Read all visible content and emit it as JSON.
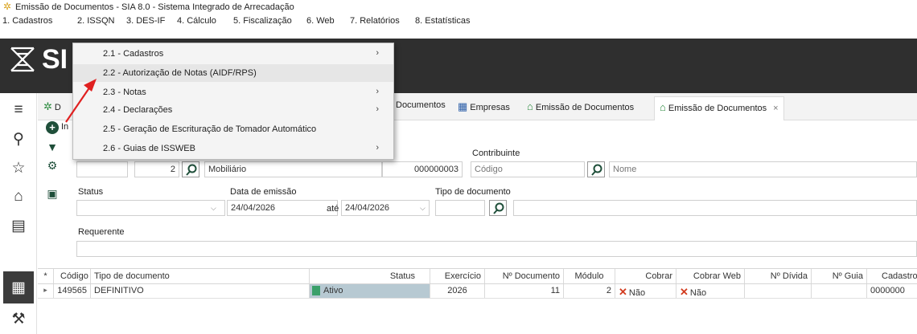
{
  "window": {
    "title": "Emissão de Documentos - SIA 8.0 - Sistema Integrado de Arrecadação"
  },
  "menubar": [
    "1. Cadastros",
    "2. ISSQN",
    "3. DES-IF",
    "4. Cálculo",
    "5. Fiscalização",
    "6. Web",
    "7. Relatórios",
    "8. Estatísticas"
  ],
  "brand": {
    "logo_text": "SI"
  },
  "dropdown": [
    {
      "label": "2.1 - Cadastros",
      "submenu": true
    },
    {
      "label": "2.2 - Autorização de Notas (AIDF/RPS)",
      "submenu": false
    },
    {
      "label": "2.3 - Notas",
      "submenu": true
    },
    {
      "label": "2.4 - Declarações",
      "submenu": true
    },
    {
      "label": "2.5 - Geração de Escrituração de Tomador Automático",
      "submenu": false
    },
    {
      "label": "2.6 - Guias de ISSWEB",
      "submenu": true
    }
  ],
  "tabs": {
    "first_partial": "D",
    "t1": "Documentos",
    "t2": "Empresas",
    "t3": "Emissão de Documentos",
    "t4": "Emissão de Documentos",
    "close": "×"
  },
  "toolbar": {
    "partial_label": "In"
  },
  "form": {
    "contribuinte_label": "Contribuinte",
    "row1_num": "2",
    "mobiliario": "Mobiliário",
    "code": "000000003",
    "codigo_placeholder": "Código",
    "nome_placeholder": "Nome",
    "status_label": "Status",
    "data_label": "Data de emissão",
    "data_from": "24/04/2026",
    "ate_label": "até",
    "data_to": "24/04/2026",
    "tipo_label": "Tipo de documento",
    "requerente_label": "Requerente"
  },
  "grid": {
    "headers": [
      "*",
      "Código",
      "Tipo de documento",
      "Status",
      "Exercício",
      "Nº Documento",
      "Módulo",
      "Cobrar",
      "Cobrar Web",
      "Nº Dívida",
      "Nº Guia",
      "Cadastro"
    ],
    "row": {
      "indicator": "▸",
      "codigo": "149565",
      "tipo": "DEFINITIVO",
      "status": "Ativo",
      "exercicio": "2026",
      "numero": "11",
      "modulo": "2",
      "cobrar": "Não",
      "cobrar_web": "Não",
      "divida": "",
      "guia": "",
      "cadastro": "0000000"
    }
  },
  "colors": {
    "banner": "#2f2f2f",
    "accent_green": "#3aa06a",
    "status_bg": "#b7c9d2",
    "x_red": "#d23b1e"
  }
}
